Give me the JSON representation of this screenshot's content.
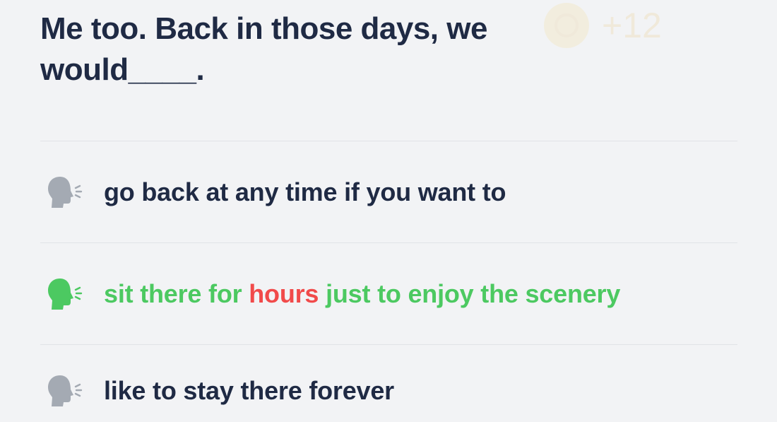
{
  "question": {
    "prompt_line1": "Me too. Back in those days, we",
    "prompt_line2": "would____."
  },
  "reward": {
    "count": "+12",
    "icon": "coin-icon"
  },
  "options": [
    {
      "text": "go back at any time if you want to",
      "icon": "speaking-head-icon",
      "state": "neutral"
    },
    {
      "text_before": "sit there for ",
      "text_highlight": "hours",
      "text_after": " just to enjoy the scenery",
      "icon": "speaking-head-icon",
      "state": "correct"
    },
    {
      "text": "like to stay there forever",
      "icon": "speaking-head-icon",
      "state": "neutral"
    }
  ],
  "colors": {
    "background": "#f2f3f5",
    "text_primary": "#1f2a44",
    "correct": "#4cc961",
    "highlight": "#f14a4a",
    "icon_neutral": "#a4aab3",
    "divider": "#e1e3e7"
  }
}
